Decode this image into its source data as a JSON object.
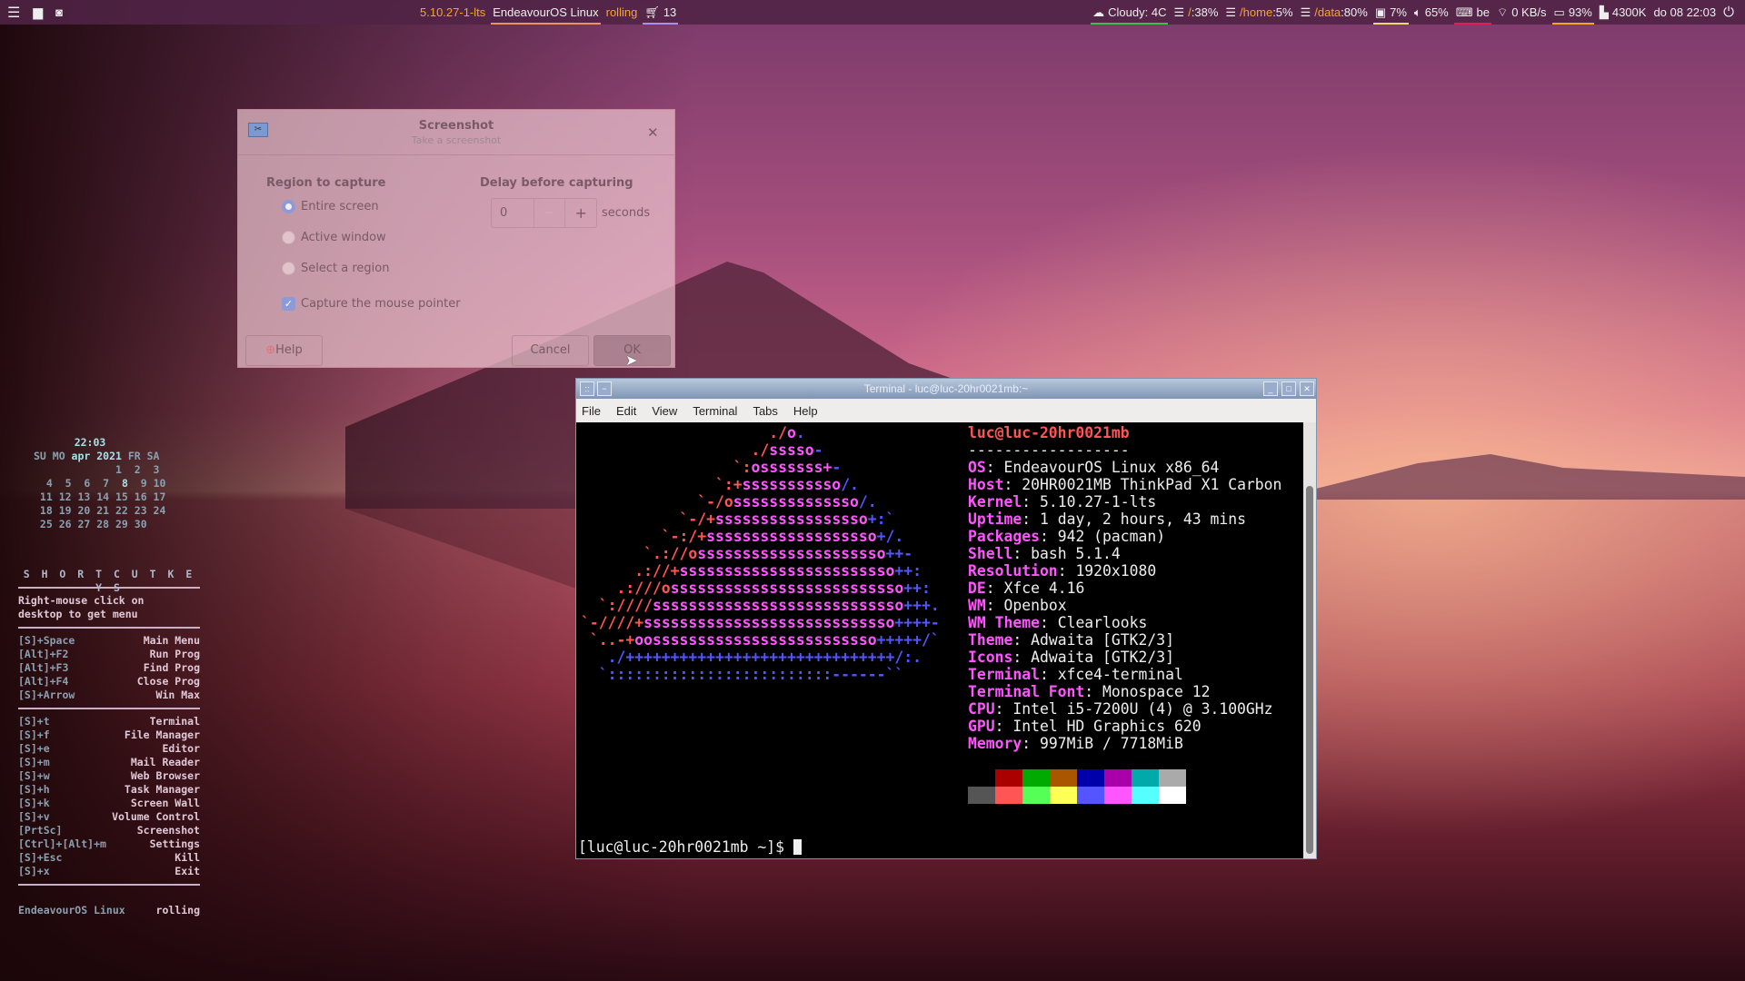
{
  "topbar": {
    "left_icons": [
      "menu-icon",
      "folder-icon",
      "camera-icon"
    ],
    "kernel": "5.10.27-1-lts",
    "distro": "EndeavourOS Linux",
    "channel": "rolling",
    "updates": "13",
    "weather": "Cloudy: 4C",
    "root_label": "/",
    "root_usage": ":38%",
    "home_label": "/home",
    "home_usage": ":5%",
    "data_label": "/data",
    "data_usage": ":80%",
    "cpu": "7%",
    "volume": "65%",
    "keyboard": "be",
    "network": "0 KB/s",
    "battery": "93%",
    "memory": "4300K",
    "clock": "do 08 22:03",
    "accent_colors": {
      "orange": "#f5a623",
      "green": "#3cc04a",
      "purple": "#a88ef0",
      "yellow": "#f0d878",
      "red": "#e0204a"
    }
  },
  "dialog": {
    "title": "Screenshot",
    "subtitle": "Take a screenshot",
    "region_heading": "Region to capture",
    "options": [
      {
        "label": "Entire screen",
        "selected": true
      },
      {
        "label": "Active window",
        "selected": false
      },
      {
        "label": "Select a region",
        "selected": false
      }
    ],
    "capture_pointer_label": "Capture the mouse pointer",
    "capture_pointer_checked": true,
    "delay_heading": "Delay before capturing",
    "delay_value": "0",
    "delay_unit": "seconds",
    "help": "Help",
    "cancel": "Cancel",
    "ok": "OK"
  },
  "terminal": {
    "title": "Terminal - luc@luc-20hr0021mb:~",
    "menu": [
      "File",
      "Edit",
      "View",
      "Terminal",
      "Tabs",
      "Help"
    ],
    "logo_colors": {
      "r": "#ff5555",
      "m": "#ff55ff",
      "b": "#5555ff"
    },
    "logo": [
      [
        [
          "                     ",
          "r"
        ],
        [
          "./",
          "r"
        ],
        [
          "o",
          "m"
        ],
        [
          ".",
          "b"
        ]
      ],
      [
        [
          "                   ./",
          "r"
        ],
        [
          "sssso",
          "m"
        ],
        [
          "-",
          "b"
        ]
      ],
      [
        [
          "                 `:",
          "r"
        ],
        [
          "osssssss+",
          "m"
        ],
        [
          "-",
          "b"
        ]
      ],
      [
        [
          "               `:+",
          "r"
        ],
        [
          "sssssssssso",
          "m"
        ],
        [
          "/.",
          "b"
        ]
      ],
      [
        [
          "             `-/o",
          "r"
        ],
        [
          "ssssssssssssso",
          "m"
        ],
        [
          "/.",
          "b"
        ]
      ],
      [
        [
          "           `-/+",
          "r"
        ],
        [
          "sssssssssssssssso",
          "m"
        ],
        [
          "+:`",
          "b"
        ]
      ],
      [
        [
          "         `-:/+",
          "r"
        ],
        [
          "sssssssssssssssssso",
          "m"
        ],
        [
          "+/.",
          "b"
        ]
      ],
      [
        [
          "       `.://o",
          "r"
        ],
        [
          "sssssssssssssssssssso",
          "m"
        ],
        [
          "++-",
          "b"
        ]
      ],
      [
        [
          "      .://+",
          "r"
        ],
        [
          "ssssssssssssssssssssssso",
          "m"
        ],
        [
          "++:",
          "b"
        ]
      ],
      [
        [
          "    .:///o",
          "r"
        ],
        [
          "ssssssssssssssssssssssssso",
          "m"
        ],
        [
          "++:",
          "b"
        ]
      ],
      [
        [
          "  `:////",
          "r"
        ],
        [
          "ssssssssssssssssssssssssssso",
          "m"
        ],
        [
          "+++.",
          "b"
        ]
      ],
      [
        [
          "`-////+",
          "r"
        ],
        [
          "ssssssssssssssssssssssssssso",
          "m"
        ],
        [
          "++++-",
          "b"
        ]
      ],
      [
        [
          " `..-+",
          "r"
        ],
        [
          "oosssssssssssssssssssssssso",
          "m"
        ],
        [
          "+++++/`",
          "b"
        ]
      ],
      [
        [
          "   ./++++++++++++++++++++++++++++++/:.",
          "b"
        ]
      ],
      [
        [
          "  `:::::::::::::::::::::::::------``",
          "b"
        ]
      ]
    ],
    "user_host": "luc@luc-20hr0021mb",
    "separator": "------------------",
    "info": [
      {
        "k": "OS",
        "v": "EndeavourOS Linux x86_64"
      },
      {
        "k": "Host",
        "v": "20HR0021MB ThinkPad X1 Carbon"
      },
      {
        "k": "Kernel",
        "v": "5.10.27-1-lts"
      },
      {
        "k": "Uptime",
        "v": "1 day, 2 hours, 43 mins"
      },
      {
        "k": "Packages",
        "v": "942 (pacman)"
      },
      {
        "k": "Shell",
        "v": "bash 5.1.4"
      },
      {
        "k": "Resolution",
        "v": "1920x1080"
      },
      {
        "k": "DE",
        "v": "Xfce 4.16"
      },
      {
        "k": "WM",
        "v": "Openbox"
      },
      {
        "k": "WM Theme",
        "v": "Clearlooks"
      },
      {
        "k": "Theme",
        "v": "Adwaita [GTK2/3]"
      },
      {
        "k": "Icons",
        "v": "Adwaita [GTK2/3]"
      },
      {
        "k": "Terminal",
        "v": "xfce4-terminal"
      },
      {
        "k": "Terminal Font",
        "v": "Monospace 12"
      },
      {
        "k": "CPU",
        "v": "Intel i5-7200U (4) @ 3.100GHz"
      },
      {
        "k": "GPU",
        "v": "Intel HD Graphics 620"
      },
      {
        "k": "Memory",
        "v": "997MiB / 7718MiB"
      }
    ],
    "palette": [
      "#000000",
      "#aa0000",
      "#00aa00",
      "#aa5500",
      "#0000aa",
      "#aa00aa",
      "#00aaaa",
      "#aaaaaa",
      "#555555",
      "#ff5555",
      "#55ff55",
      "#ffff55",
      "#5555ff",
      "#ff55ff",
      "#55ffff",
      "#ffffff"
    ],
    "prompt": "[luc@luc-20hr0021mb ~]$ "
  },
  "conky": {
    "time": "22:03",
    "cal_header": [
      "SU MO ",
      "apr 2021",
      " FR SA"
    ],
    "cal_rows": [
      "             1  2  3",
      "  4  5  6  7 ",
      " 8",
      "  9 10",
      " 11 12 13 14 15 16 17",
      " 18 19 20 21 22 23 24",
      " 25 26 27 28 29 30"
    ],
    "today": "8",
    "heading": "S H O R T C U T   K E Y S",
    "hint": "Right-mouse click on\ndesktop to get menu",
    "group1": [
      [
        "[S]+Space",
        "Main Menu"
      ],
      [
        "[Alt]+F2",
        "Run Prog"
      ],
      [
        "[Alt]+F3",
        "Find Prog"
      ],
      [
        "[Alt]+F4",
        "Close Prog"
      ],
      [
        "[S]+Arrow",
        "Win Max"
      ]
    ],
    "group2": [
      [
        "[S]+t",
        "Terminal"
      ],
      [
        "[S]+f",
        "File Manager"
      ],
      [
        "[S]+e",
        "Editor"
      ],
      [
        "[S]+m",
        "Mail Reader"
      ],
      [
        "[S]+w",
        "Web Browser"
      ],
      [
        "[S]+h",
        "Task Manager"
      ],
      [
        "[S]+k",
        "Screen Wall"
      ],
      [
        "[S]+v",
        "Volume Control"
      ],
      [
        "[PrtSc]",
        "Screenshot"
      ],
      [
        "[Ctrl]+[Alt]+m",
        "Settings"
      ],
      [
        "[S]+Esc",
        "Kill"
      ],
      [
        "[S]+x",
        "Exit"
      ]
    ],
    "footer_left": "EndeavourOS Linux",
    "footer_right": "rolling"
  }
}
